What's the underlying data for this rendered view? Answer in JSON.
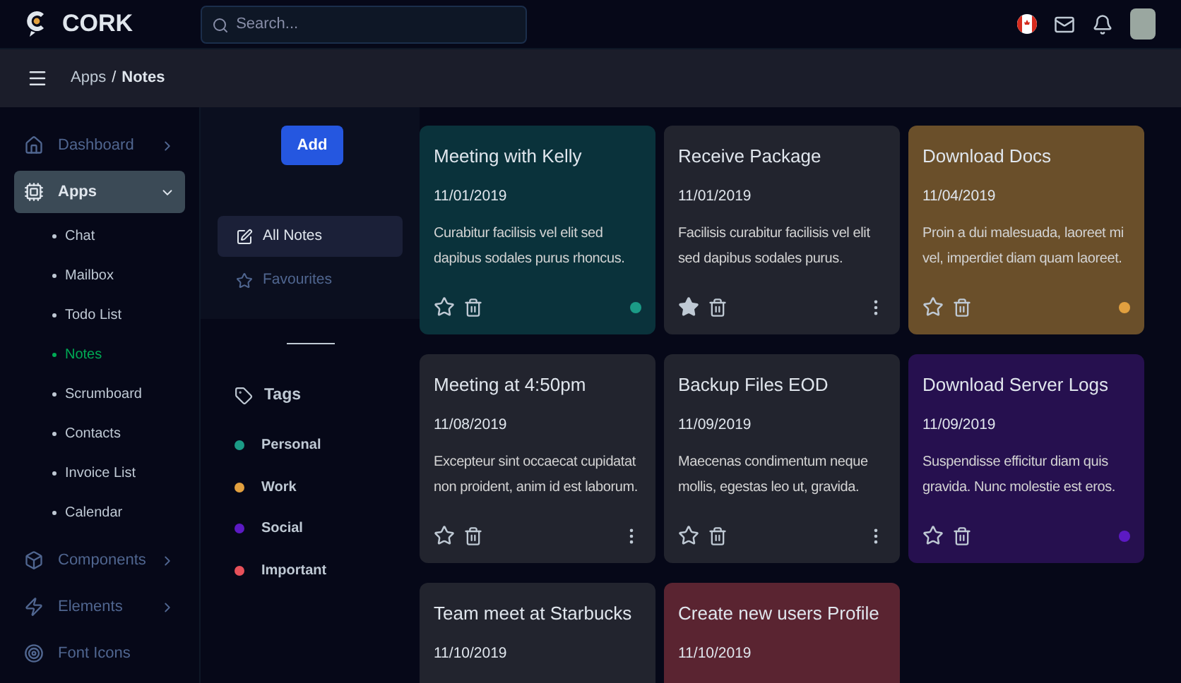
{
  "brand": "CORK",
  "search": {
    "placeholder": "Search..."
  },
  "breadcrumb": {
    "parent": "Apps",
    "separator": "/",
    "current": "Notes"
  },
  "sidebar": {
    "items": [
      {
        "label": "Dashboard",
        "expanded": false,
        "selected": false
      },
      {
        "label": "Apps",
        "expanded": true,
        "selected": true,
        "children": [
          {
            "label": "Chat",
            "selected": false
          },
          {
            "label": "Mailbox",
            "selected": false
          },
          {
            "label": "Todo List",
            "selected": false
          },
          {
            "label": "Notes",
            "selected": true
          },
          {
            "label": "Scrumboard",
            "selected": false
          },
          {
            "label": "Contacts",
            "selected": false
          },
          {
            "label": "Invoice List",
            "selected": false
          },
          {
            "label": "Calendar",
            "selected": false
          }
        ]
      },
      {
        "label": "Components",
        "expanded": false,
        "selected": false
      },
      {
        "label": "Elements",
        "expanded": false,
        "selected": false
      },
      {
        "label": "Font Icons",
        "selected": false
      }
    ]
  },
  "notes_nav": {
    "add_button": "Add",
    "filters": [
      {
        "label": "All Notes",
        "selected": true
      },
      {
        "label": "Favourites",
        "selected": false
      }
    ],
    "tags_heading": "Tags",
    "tags": [
      {
        "label": "Personal",
        "color": "#1b9b86"
      },
      {
        "label": "Work",
        "color": "#e2a03f"
      },
      {
        "label": "Social",
        "color": "#5c1ac3"
      },
      {
        "label": "Important",
        "color": "#e7515a"
      }
    ]
  },
  "notes": [
    {
      "title": "Meeting with Kelly",
      "date": "11/01/2019",
      "body": "Curabitur facilisis vel elit sed dapibus sodales purus rhoncus.",
      "favourite": false,
      "color": "#1b9b86"
    },
    {
      "title": "Receive Package",
      "date": "11/01/2019",
      "body": "Facilisis curabitur facilisis vel elit sed dapibus sodales purus.",
      "favourite": true
    },
    {
      "title": "Download Docs",
      "date": "11/04/2019",
      "body": "Proin a dui malesuada, laoreet mi vel, imperdiet diam quam laoreet.",
      "favourite": false,
      "color": "#e2a03f"
    },
    {
      "title": "Meeting at 4:50pm",
      "date": "11/08/2019",
      "body": "Excepteur sint occaecat cupidatat non proident, anim id est laborum.",
      "favourite": false
    },
    {
      "title": "Backup Files EOD",
      "date": "11/09/2019",
      "body": "Maecenas condimentum neque mollis, egestas leo ut, gravida.",
      "favourite": false
    },
    {
      "title": "Download Server Logs",
      "date": "11/09/2019",
      "body": "Suspendisse efficitur diam quis gravida. Nunc molestie est eros.",
      "favourite": false,
      "color": "#5c1ac3"
    },
    {
      "title": "Team meet at Starbucks",
      "date": "11/10/2019"
    },
    {
      "title": "Create new users Profile",
      "date": "11/10/2019",
      "color": "#5a2431"
    }
  ]
}
